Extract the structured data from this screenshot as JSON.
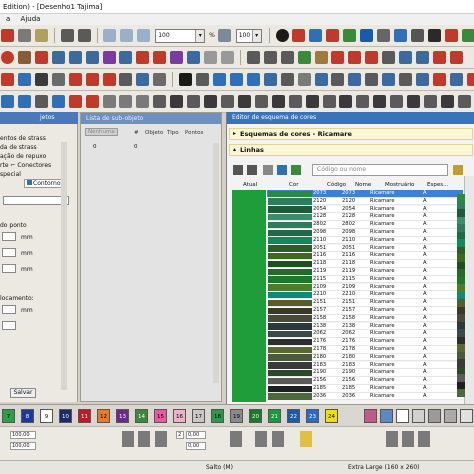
{
  "window": {
    "title": "Edition) - [Desenho1     Tajima]"
  },
  "menu": {
    "items": [
      "a",
      "Ajuda"
    ]
  },
  "toolbar": {
    "zoom_value": "100",
    "zoom_unit": "%",
    "combo2_value": "100",
    "colors": [
      "#b8860b",
      "#2f6fb6",
      "#444444",
      "#9b2a2a",
      "#c87a2a",
      "#3a8a3a",
      "#555555",
      "#7a3aa0",
      "#2a6a9a",
      "#aa4444",
      "#666666",
      "#2a2a2a",
      "#8a8a3a",
      "#3a5a9a",
      "#444444",
      "#b03030"
    ]
  },
  "left_panel": {
    "tab_label": "jetos",
    "lines": [
      "entos de strass",
      "da de strass",
      "ação de repuxo",
      "rte  ⌐ Conectores",
      "special"
    ],
    "contours_tab": "Contornos",
    "ponto_label": "do ponto",
    "mm1": "mm",
    "mm2": "mm",
    "mm3": "mm",
    "mm4": "mm",
    "locamento_label": "locamento:",
    "salvar": "Salvar"
  },
  "object_panel": {
    "title": "Lista de sub-objeto",
    "columns": [
      "#",
      "Objeto",
      "Tipo",
      "Pontos"
    ],
    "col_left": "Nenhuma",
    "values": [
      "0",
      "0"
    ]
  },
  "editor": {
    "title": "Editor de esquema de cores",
    "scheme_section": "Esquemas de cores - Ricamare",
    "lines_section": "Linhas",
    "search_placeholder": "Código ou nome",
    "columns": [
      "Atual",
      "Cor",
      "Código",
      "Nome",
      "Mostruário",
      "Espes..."
    ],
    "rows": [
      {
        "code": "2073",
        "name": "2073",
        "brand": "Ricamare",
        "thick": "A",
        "color": "#2a8a3f",
        "selected": true
      },
      {
        "code": "2120",
        "name": "2120",
        "brand": "Ricamare",
        "thick": "A",
        "color": "#2e7d5b"
      },
      {
        "code": "2054",
        "name": "2054",
        "brand": "Ricamare",
        "thick": "A",
        "color": "#1f5a3a"
      },
      {
        "code": "2128",
        "name": "2128",
        "brand": "Ricamare",
        "thick": "A",
        "color": "#3a8f6a"
      },
      {
        "code": "2802",
        "name": "2802",
        "brand": "Ricamare",
        "thick": "A",
        "color": "#2f7a5c"
      },
      {
        "code": "2098",
        "name": "2098",
        "brand": "Ricamare",
        "thick": "A",
        "color": "#1d6a46"
      },
      {
        "code": "2110",
        "name": "2110",
        "brand": "Ricamare",
        "thick": "A",
        "color": "#0f8a5a"
      },
      {
        "code": "2051",
        "name": "2051",
        "brand": "Ricamare",
        "thick": "A",
        "color": "#2b5e2a"
      },
      {
        "code": "2116",
        "name": "2116",
        "brand": "Ricamare",
        "thick": "A",
        "color": "#3e6a20"
      },
      {
        "code": "2118",
        "name": "2118",
        "brand": "Ricamare",
        "thick": "A",
        "color": "#1e4f1f"
      },
      {
        "code": "2119",
        "name": "2119",
        "brand": "Ricamare",
        "thick": "A",
        "color": "#246a2a"
      },
      {
        "code": "2115",
        "name": "2115",
        "brand": "Ricamare",
        "thick": "A",
        "color": "#1a7a2a"
      },
      {
        "code": "2109",
        "name": "2109",
        "brand": "Ricamare",
        "thick": "A",
        "color": "#4b7d2b"
      },
      {
        "code": "2210",
        "name": "2210",
        "brand": "Ricamare",
        "thick": "A",
        "color": "#0e8a7a"
      },
      {
        "code": "2151",
        "name": "2151",
        "brand": "Ricamare",
        "thick": "A",
        "color": "#5a5a2a"
      },
      {
        "code": "2157",
        "name": "2157",
        "brand": "Ricamare",
        "thick": "A",
        "color": "#3a3a2a"
      },
      {
        "code": "2158",
        "name": "2158",
        "brand": "Ricamare",
        "thick": "A",
        "color": "#4a4a3a"
      },
      {
        "code": "2138",
        "name": "2138",
        "brand": "Ricamare",
        "thick": "A",
        "color": "#2a3a3a"
      },
      {
        "code": "2062",
        "name": "2062",
        "brand": "Ricamare",
        "thick": "A",
        "color": "#3a4a4a"
      },
      {
        "code": "2176",
        "name": "2176",
        "brand": "Ricamare",
        "thick": "A",
        "color": "#2e2e2e"
      },
      {
        "code": "2178",
        "name": "2178",
        "brand": "Ricamare",
        "thick": "A",
        "color": "#5a6a2a"
      },
      {
        "code": "2180",
        "name": "2180",
        "brand": "Ricamare",
        "thick": "A",
        "color": "#4a5a3a"
      },
      {
        "code": "2183",
        "name": "2183",
        "brand": "Ricamare",
        "thick": "A",
        "color": "#3a3a3a"
      },
      {
        "code": "2190",
        "name": "2190",
        "brand": "Ricamare",
        "thick": "A",
        "color": "#2a4a2a"
      },
      {
        "code": "2156",
        "name": "2156",
        "brand": "Ricamare",
        "thick": "A",
        "color": "#5a5a5a"
      },
      {
        "code": "2185",
        "name": "2185",
        "brand": "Ricamare",
        "thick": "A",
        "color": "#1f1f1f"
      },
      {
        "code": "2036",
        "name": "2036",
        "brand": "Ricamare",
        "thick": "A",
        "color": "#4a6a3a"
      }
    ]
  },
  "palette": [
    {
      "label": "7",
      "bg": "#2aa04a",
      "fg": "#000"
    },
    {
      "label": "8",
      "bg": "#1a3a9a",
      "fg": "#fff"
    },
    {
      "label": "9",
      "bg": "#ffffff",
      "fg": "#000"
    },
    {
      "label": "10",
      "bg": "#1a2a6a",
      "fg": "#fff"
    },
    {
      "label": "11",
      "bg": "#c01a2a",
      "fg": "#fff"
    },
    {
      "label": "12",
      "bg": "#e87a2a",
      "fg": "#000"
    },
    {
      "label": "13",
      "bg": "#6a2a8a",
      "fg": "#fff"
    },
    {
      "label": "14",
      "bg": "#3a8a3a",
      "fg": "#fff"
    },
    {
      "label": "15",
      "bg": "#e85aa0",
      "fg": "#000"
    },
    {
      "label": "16",
      "bg": "#f0b0c8",
      "fg": "#000"
    },
    {
      "label": "17",
      "bg": "#c8c8c8",
      "fg": "#000"
    },
    {
      "label": "18",
      "bg": "#2a9a4a",
      "fg": "#000"
    },
    {
      "label": "19",
      "bg": "#8a8a8a",
      "fg": "#000"
    },
    {
      "label": "20",
      "bg": "#1a7a2a",
      "fg": "#fff"
    },
    {
      "label": "21",
      "bg": "#1a9a3a",
      "fg": "#fff"
    },
    {
      "label": "22",
      "bg": "#1a5aaa",
      "fg": "#fff"
    },
    {
      "label": "23",
      "bg": "#2a6ac8",
      "fg": "#fff"
    },
    {
      "label": "24",
      "bg": "#f0e000",
      "fg": "#000"
    }
  ],
  "bottom": {
    "field1": "100,00",
    "field2": "100,00",
    "field3": "0,00",
    "field4": "0,00",
    "field5": "2"
  },
  "status": {
    "stitch": "Salto (M)",
    "size": "Extra Large (160 x 260)"
  }
}
